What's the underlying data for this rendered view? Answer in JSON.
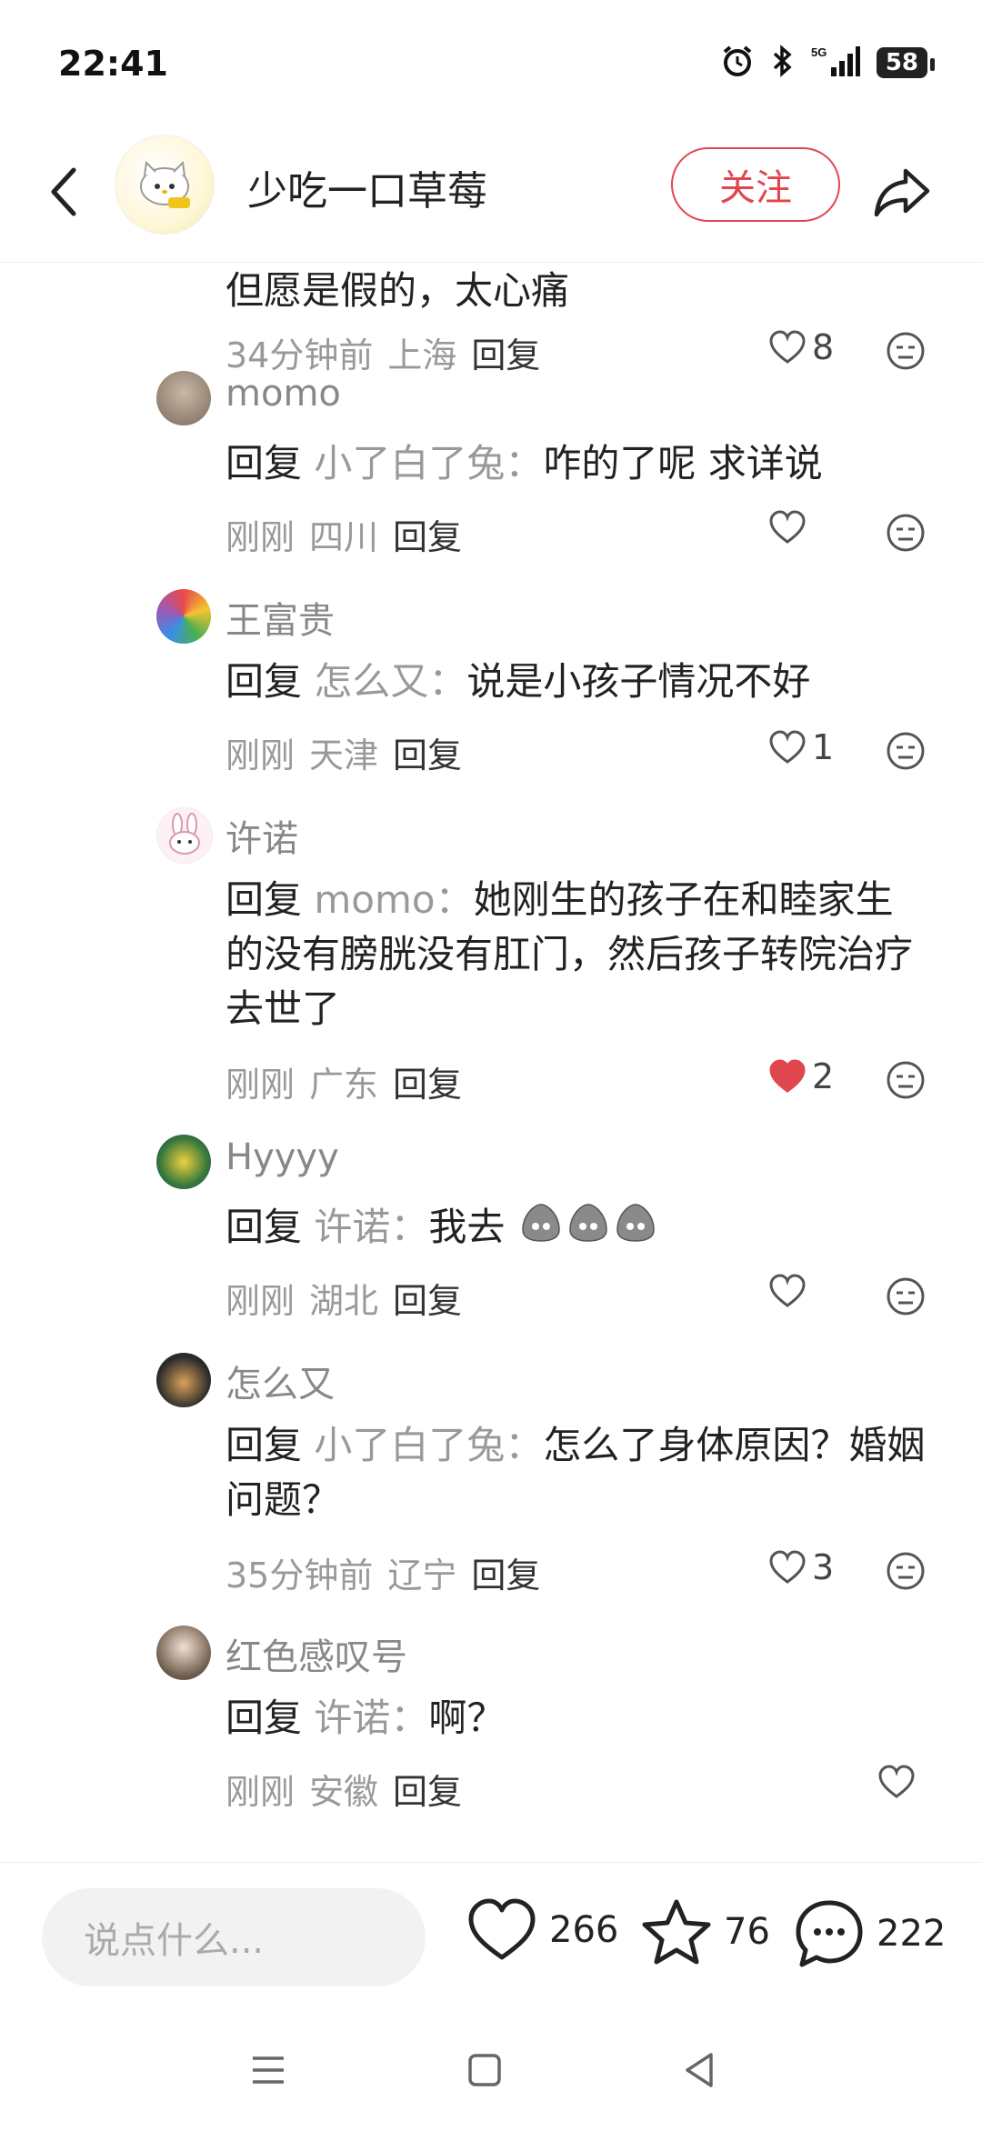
{
  "status": {
    "time": "22:41",
    "battery": "58",
    "network": "5G"
  },
  "header": {
    "title": "少吃一口草莓",
    "follow_label": "关注"
  },
  "comments": [
    {
      "body": "但愿是假的，太心痛",
      "time": "34分钟前",
      "location": "上海",
      "reply_label": "回复",
      "likes": "8",
      "liked": false
    },
    {
      "name": "momo",
      "reply_prefix": "回复",
      "reply_target": "小了白了兔：",
      "body": "咋的了呢 求详说",
      "time": "刚刚",
      "location": "四川",
      "reply_label": "回复",
      "likes": "",
      "liked": false
    },
    {
      "name": "王富贵",
      "reply_prefix": "回复",
      "reply_target": "怎么又：",
      "body": "说是小孩子情况不好",
      "time": "刚刚",
      "location": "天津",
      "reply_label": "回复",
      "likes": "1",
      "liked": false
    },
    {
      "name": "许诺",
      "reply_prefix": "回复",
      "reply_target": "momo：",
      "body": "她刚生的孩子在和睦家生的没有膀胱没有肛门，然后孩子转院治疗去世了",
      "time": "刚刚",
      "location": "广东",
      "reply_label": "回复",
      "likes": "2",
      "liked": true
    },
    {
      "name": "Hyyyy",
      "reply_prefix": "回复",
      "reply_target": "许诺：",
      "body": "我去",
      "time": "刚刚",
      "location": "湖北",
      "reply_label": "回复",
      "likes": "",
      "liked": false
    },
    {
      "name": "怎么又",
      "reply_prefix": "回复",
      "reply_target": "小了白了兔：",
      "body": "怎么了身体原因？婚姻问题？",
      "time": "35分钟前",
      "location": "辽宁",
      "reply_label": "回复",
      "likes": "3",
      "liked": false
    },
    {
      "name": "红色感叹号",
      "reply_prefix": "回复",
      "reply_target": "许诺：",
      "body": "啊？",
      "time": "刚刚",
      "location": "安徽",
      "reply_label": "回复",
      "likes": "",
      "liked": false
    }
  ],
  "bottom": {
    "input_placeholder": "说点什么...",
    "likes": "266",
    "stars": "76",
    "comments": "222"
  },
  "colors": {
    "accent": "#e0464e",
    "muted": "#999999"
  }
}
